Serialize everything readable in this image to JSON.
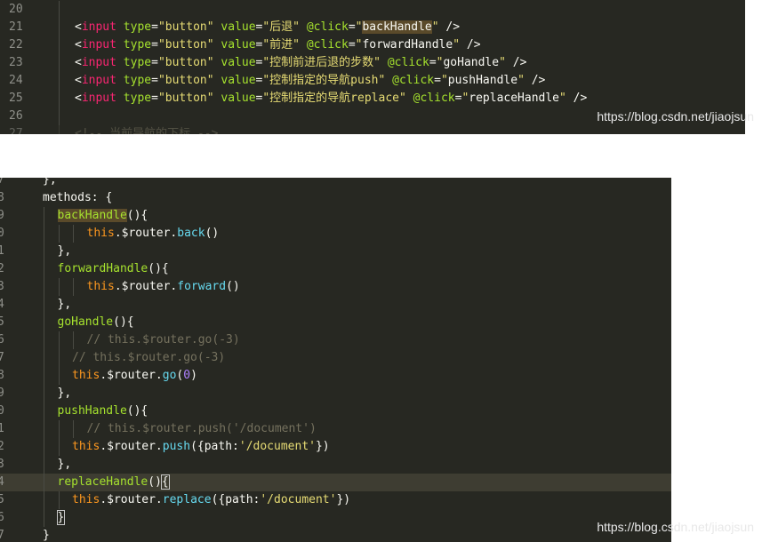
{
  "top_editor": {
    "lines": [
      {
        "num": "20",
        "tokens": []
      },
      {
        "num": "21",
        "tokens": [
          {
            "t": "<",
            "c": "t-punc"
          },
          {
            "t": "input",
            "c": "t-tag"
          },
          {
            "t": " type",
            "c": "t-attr"
          },
          {
            "t": "=",
            "c": "t-punc"
          },
          {
            "t": "\"button\"",
            "c": "t-str"
          },
          {
            "t": " value",
            "c": "t-attr"
          },
          {
            "t": "=",
            "c": "t-punc"
          },
          {
            "t": "\"后退\"",
            "c": "t-str"
          },
          {
            "t": " @click",
            "c": "t-attr"
          },
          {
            "t": "=",
            "c": "t-punc"
          },
          {
            "t": "\"",
            "c": "t-str"
          },
          {
            "t": "backHandle",
            "c": "t-val hl-word"
          },
          {
            "t": "\"",
            "c": "t-str"
          },
          {
            "t": " />",
            "c": "t-punc"
          }
        ]
      },
      {
        "num": "22",
        "tokens": [
          {
            "t": "<",
            "c": "t-punc"
          },
          {
            "t": "input",
            "c": "t-tag"
          },
          {
            "t": " type",
            "c": "t-attr"
          },
          {
            "t": "=",
            "c": "t-punc"
          },
          {
            "t": "\"button\"",
            "c": "t-str"
          },
          {
            "t": " value",
            "c": "t-attr"
          },
          {
            "t": "=",
            "c": "t-punc"
          },
          {
            "t": "\"前进\"",
            "c": "t-str"
          },
          {
            "t": " @click",
            "c": "t-attr"
          },
          {
            "t": "=",
            "c": "t-punc"
          },
          {
            "t": "\"",
            "c": "t-str"
          },
          {
            "t": "forwardHandle",
            "c": "t-val"
          },
          {
            "t": "\"",
            "c": "t-str"
          },
          {
            "t": " />",
            "c": "t-punc"
          }
        ]
      },
      {
        "num": "23",
        "tokens": [
          {
            "t": "<",
            "c": "t-punc"
          },
          {
            "t": "input",
            "c": "t-tag"
          },
          {
            "t": " type",
            "c": "t-attr"
          },
          {
            "t": "=",
            "c": "t-punc"
          },
          {
            "t": "\"button\"",
            "c": "t-str"
          },
          {
            "t": " value",
            "c": "t-attr"
          },
          {
            "t": "=",
            "c": "t-punc"
          },
          {
            "t": "\"控制前进后退的步数\"",
            "c": "t-str"
          },
          {
            "t": " @click",
            "c": "t-attr"
          },
          {
            "t": "=",
            "c": "t-punc"
          },
          {
            "t": "\"",
            "c": "t-str"
          },
          {
            "t": "goHandle",
            "c": "t-val"
          },
          {
            "t": "\"",
            "c": "t-str"
          },
          {
            "t": " />",
            "c": "t-punc"
          }
        ]
      },
      {
        "num": "24",
        "tokens": [
          {
            "t": "<",
            "c": "t-punc"
          },
          {
            "t": "input",
            "c": "t-tag"
          },
          {
            "t": " type",
            "c": "t-attr"
          },
          {
            "t": "=",
            "c": "t-punc"
          },
          {
            "t": "\"button\"",
            "c": "t-str"
          },
          {
            "t": " value",
            "c": "t-attr"
          },
          {
            "t": "=",
            "c": "t-punc"
          },
          {
            "t": "\"控制指定的导航push\"",
            "c": "t-str"
          },
          {
            "t": " @click",
            "c": "t-attr"
          },
          {
            "t": "=",
            "c": "t-punc"
          },
          {
            "t": "\"",
            "c": "t-str"
          },
          {
            "t": "pushHandle",
            "c": "t-val"
          },
          {
            "t": "\"",
            "c": "t-str"
          },
          {
            "t": " />",
            "c": "t-punc"
          }
        ]
      },
      {
        "num": "25",
        "tokens": [
          {
            "t": "<",
            "c": "t-punc"
          },
          {
            "t": "input",
            "c": "t-tag"
          },
          {
            "t": " type",
            "c": "t-attr"
          },
          {
            "t": "=",
            "c": "t-punc"
          },
          {
            "t": "\"button\"",
            "c": "t-str"
          },
          {
            "t": " value",
            "c": "t-attr"
          },
          {
            "t": "=",
            "c": "t-punc"
          },
          {
            "t": "\"控制指定的导航replace\"",
            "c": "t-str"
          },
          {
            "t": " @click",
            "c": "t-attr"
          },
          {
            "t": "=",
            "c": "t-punc"
          },
          {
            "t": "\"",
            "c": "t-str"
          },
          {
            "t": "replaceHandle",
            "c": "t-val"
          },
          {
            "t": "\"",
            "c": "t-str"
          },
          {
            "t": " />",
            "c": "t-punc"
          }
        ]
      },
      {
        "num": "26",
        "tokens": []
      },
      {
        "num": "27",
        "faded": true,
        "tokens": [
          {
            "t": "<!-- 当前导航的下标 -->",
            "c": "t-comment"
          }
        ]
      }
    ],
    "watermark": "https://blog.csdn.net/jiaojsun"
  },
  "bottom_editor": {
    "lines": [
      {
        "num": "7",
        "indent": 0,
        "tokens": [
          {
            "t": "},",
            "c": "t-punc"
          }
        ]
      },
      {
        "num": "8",
        "indent": 0,
        "tokens": [
          {
            "t": "methods: {",
            "c": "t-punc"
          }
        ]
      },
      {
        "num": "9",
        "indent": 1,
        "tokens": [
          {
            "t": "backHandle",
            "c": "t-fn hl-word"
          },
          {
            "t": "(){",
            "c": "t-punc"
          }
        ]
      },
      {
        "num": "0",
        "indent": 3,
        "tokens": [
          {
            "t": "this",
            "c": "t-this"
          },
          {
            "t": ".$router.",
            "c": "t-punc"
          },
          {
            "t": "back",
            "c": "t-prop"
          },
          {
            "t": "()",
            "c": "t-punc"
          }
        ]
      },
      {
        "num": "1",
        "indent": 1,
        "tokens": [
          {
            "t": "},",
            "c": "t-punc"
          }
        ]
      },
      {
        "num": "2",
        "indent": 1,
        "tokens": [
          {
            "t": "forwardHandle",
            "c": "t-fn"
          },
          {
            "t": "(){",
            "c": "t-punc"
          }
        ]
      },
      {
        "num": "3",
        "indent": 3,
        "tokens": [
          {
            "t": "this",
            "c": "t-this"
          },
          {
            "t": ".$router.",
            "c": "t-punc"
          },
          {
            "t": "forward",
            "c": "t-prop"
          },
          {
            "t": "()",
            "c": "t-punc"
          }
        ]
      },
      {
        "num": "4",
        "indent": 1,
        "tokens": [
          {
            "t": "},",
            "c": "t-punc"
          }
        ]
      },
      {
        "num": "5",
        "indent": 1,
        "tokens": [
          {
            "t": "goHandle",
            "c": "t-fn"
          },
          {
            "t": "(){",
            "c": "t-punc"
          }
        ]
      },
      {
        "num": "6",
        "indent": 3,
        "tokens": [
          {
            "t": "// this.$router.go(-3)",
            "c": "t-comment"
          }
        ]
      },
      {
        "num": "7",
        "indent": 2,
        "tokens": [
          {
            "t": "// this.$router.go(-3)",
            "c": "t-comment"
          }
        ]
      },
      {
        "num": "8",
        "indent": 2,
        "tokens": [
          {
            "t": "this",
            "c": "t-this"
          },
          {
            "t": ".$router.",
            "c": "t-punc"
          },
          {
            "t": "go",
            "c": "t-prop"
          },
          {
            "t": "(",
            "c": "t-punc"
          },
          {
            "t": "0",
            "c": "t-num"
          },
          {
            "t": ")",
            "c": "t-punc"
          }
        ]
      },
      {
        "num": "9",
        "indent": 1,
        "tokens": [
          {
            "t": "},",
            "c": "t-punc"
          }
        ]
      },
      {
        "num": "0",
        "indent": 1,
        "tokens": [
          {
            "t": "pushHandle",
            "c": "t-fn"
          },
          {
            "t": "(){",
            "c": "t-punc"
          }
        ]
      },
      {
        "num": "1",
        "indent": 3,
        "tokens": [
          {
            "t": "// this.$router.push('/document')",
            "c": "t-comment"
          }
        ]
      },
      {
        "num": "2",
        "indent": 2,
        "tokens": [
          {
            "t": "this",
            "c": "t-this"
          },
          {
            "t": ".$router.",
            "c": "t-punc"
          },
          {
            "t": "push",
            "c": "t-prop"
          },
          {
            "t": "({path:",
            "c": "t-punc"
          },
          {
            "t": "'/document'",
            "c": "t-str"
          },
          {
            "t": "})",
            "c": "t-punc"
          }
        ]
      },
      {
        "num": "3",
        "indent": 1,
        "tokens": [
          {
            "t": "},",
            "c": "t-punc"
          }
        ]
      },
      {
        "num": "4",
        "indent": 1,
        "current": true,
        "tokens": [
          {
            "t": "replaceHandle",
            "c": "t-fn"
          },
          {
            "t": "()",
            "c": "t-punc"
          },
          {
            "t": "{",
            "c": "t-punc hl-bracket"
          }
        ]
      },
      {
        "num": "5",
        "indent": 2,
        "tokens": [
          {
            "t": "this",
            "c": "t-this"
          },
          {
            "t": ".$router.",
            "c": "t-punc"
          },
          {
            "t": "replace",
            "c": "t-prop"
          },
          {
            "t": "({path:",
            "c": "t-punc"
          },
          {
            "t": "'/document'",
            "c": "t-str"
          },
          {
            "t": "})",
            "c": "t-punc"
          }
        ]
      },
      {
        "num": "6",
        "indent": 1,
        "tokens": [
          {
            "t": "}",
            "c": "t-punc hl-bracket"
          }
        ]
      },
      {
        "num": "7",
        "indent": 0,
        "tokens": [
          {
            "t": "}",
            "c": "t-punc"
          }
        ]
      }
    ],
    "watermark": "https://blog.csdn.net/jiaojsun"
  }
}
